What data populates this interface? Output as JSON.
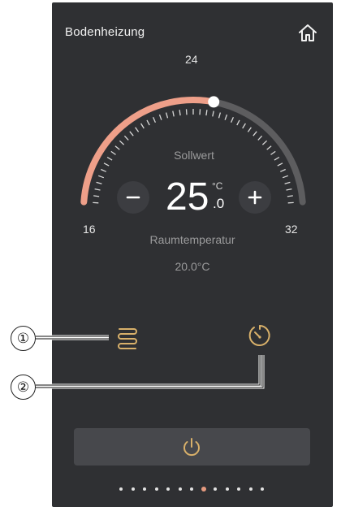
{
  "header": {
    "title": "Bodenheizung",
    "home_icon": "home-icon"
  },
  "dial": {
    "scale_top": "24",
    "scale_min": "16",
    "scale_max": "32",
    "min_value": 16,
    "max_value": 32,
    "setpoint_value": 25.0,
    "active_color": "#ee9f89",
    "track_color": "#5d5d5f",
    "knob_color": "#ffffff"
  },
  "setpoint": {
    "label": "Sollwert",
    "integer": "25",
    "unit": "°C",
    "decimal": ".0",
    "minus_icon": "minus-icon",
    "plus_icon": "plus-icon"
  },
  "room": {
    "label": "Raumtemperatur",
    "value": "20.0°C"
  },
  "controls": {
    "heat_mode_icon": "floor-heating-icon",
    "timer_icon": "timer-icon",
    "power_icon": "power-icon",
    "accent_color": "#d8b06a"
  },
  "callouts": {
    "one": "①",
    "two": "②"
  },
  "pagination": {
    "count": 13,
    "active_index": 7
  }
}
